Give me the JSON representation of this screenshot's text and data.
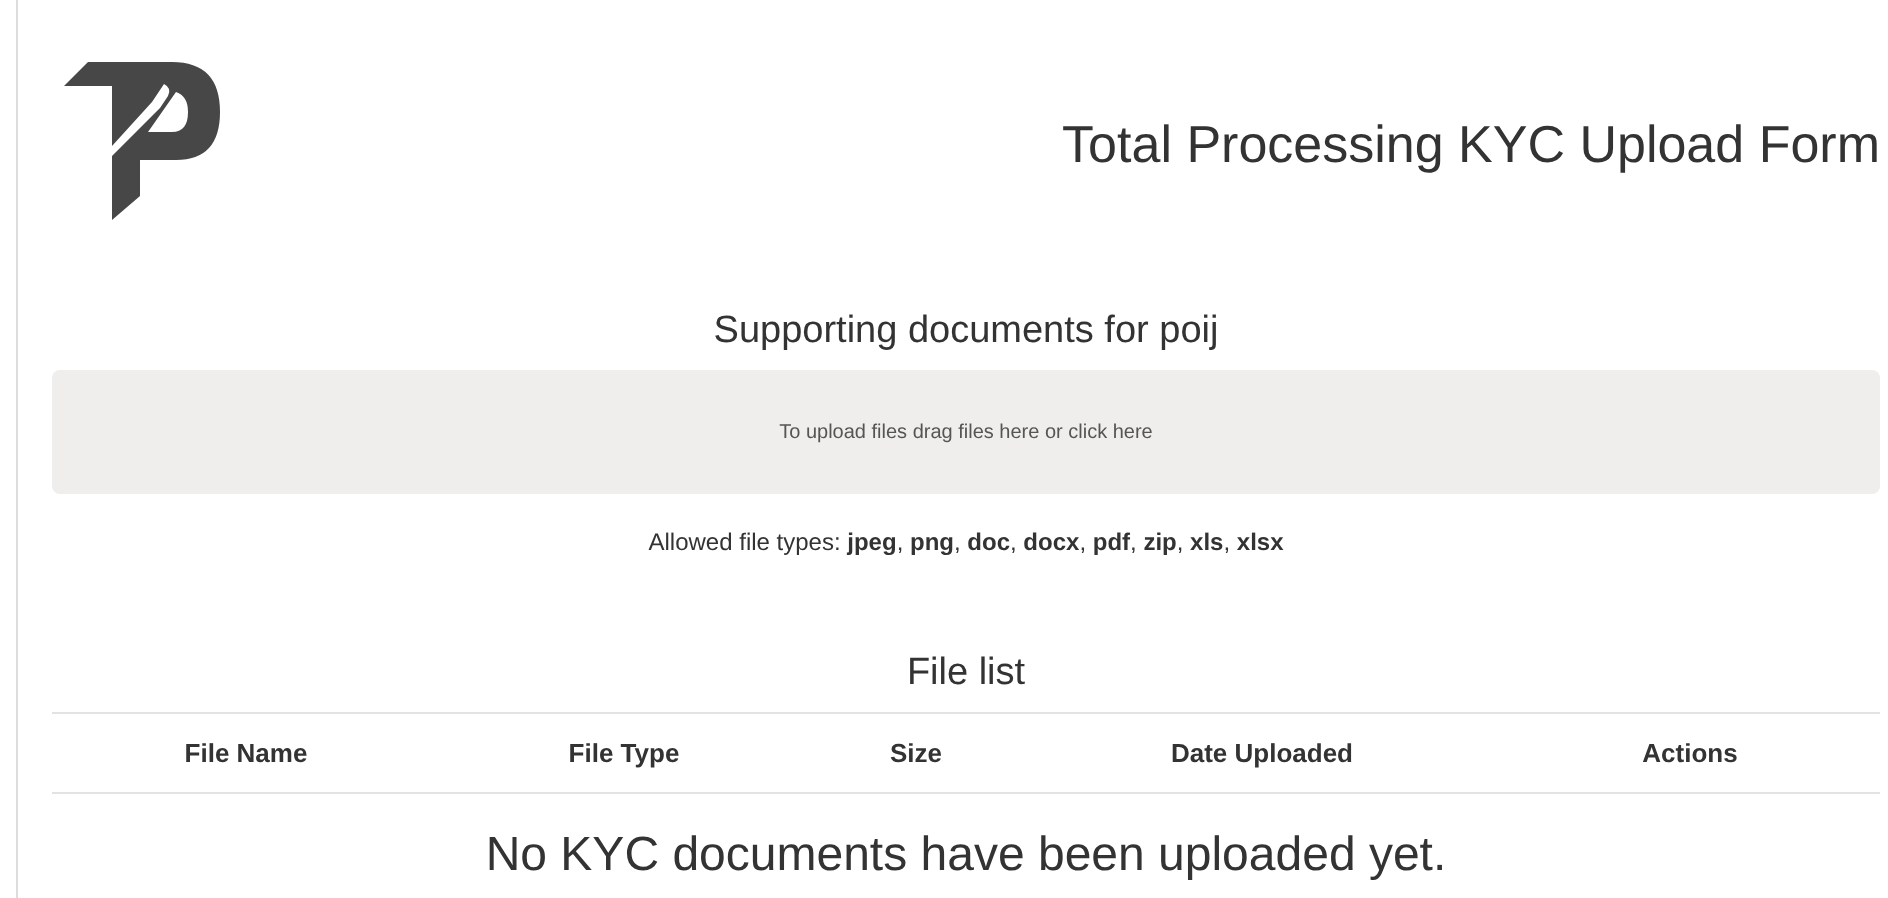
{
  "header": {
    "title": "Total Processing KYC Upload Form"
  },
  "upload": {
    "heading": "Supporting documents for poij",
    "dropzone_text": "To upload files drag files here or click here",
    "allowed_types": "Allowed file types: **jpeg**, **png**, **doc**, **docx**, **pdf**, **zip**, **xls**, **xlsx**"
  },
  "file_list": {
    "heading": "File list",
    "columns": [
      "File Name",
      "File Type",
      "Size",
      "Date Uploaded",
      "Actions"
    ],
    "empty_message": "No KYC documents have been uploaded yet."
  }
}
